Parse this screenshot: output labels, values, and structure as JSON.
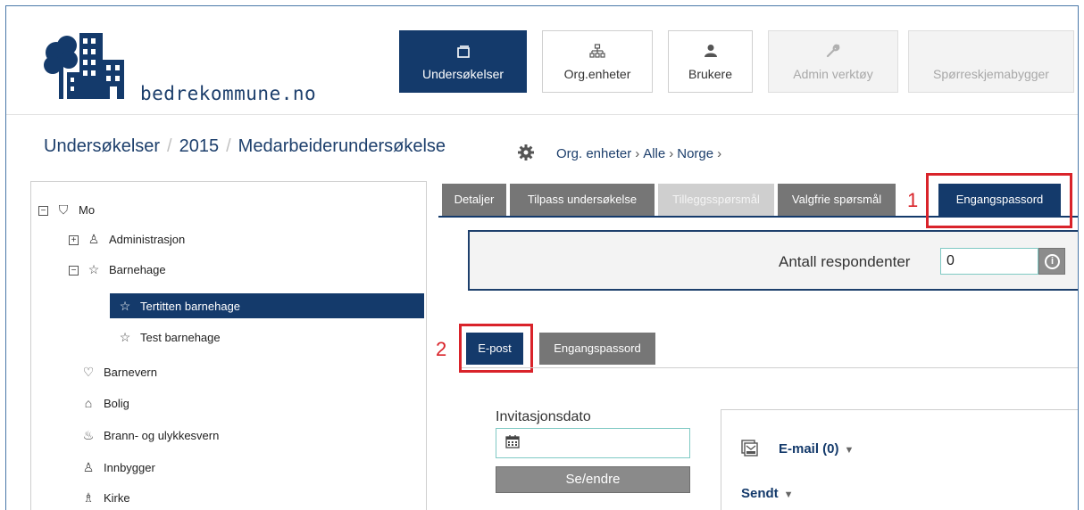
{
  "brand": {
    "name": "bedrekommune.no"
  },
  "nav": [
    {
      "label": "Undersøkelser",
      "icon": "window-icon",
      "state": "active"
    },
    {
      "label": "Org.enheter",
      "icon": "org-chart-icon",
      "state": "normal"
    },
    {
      "label": "Brukere",
      "icon": "user-icon",
      "state": "normal"
    },
    {
      "label": "Admin verktøy",
      "icon": "wrench-icon",
      "state": "disabled"
    },
    {
      "label": "Spørreskjemabygger",
      "icon": "",
      "state": "disabled"
    }
  ],
  "breadcrumb": {
    "items": [
      "Undersøkelser",
      "2015",
      "Medarbeiderundersøkelse"
    ],
    "separator": "/"
  },
  "org_path": {
    "items": [
      "Org. enheter",
      "Alle",
      "Norge"
    ]
  },
  "tree": [
    {
      "label": "Mo",
      "expander": "minus",
      "icon": "shield-icon"
    },
    {
      "label": "Administrasjon",
      "expander": "plus",
      "icon": "people-icon"
    },
    {
      "label": "Barnehage",
      "expander": "minus",
      "icon": "children-icon"
    },
    {
      "label": "Tertitten barnehage",
      "expander": "",
      "icon": "children-icon",
      "selected": true
    },
    {
      "label": "Test barnehage",
      "expander": "",
      "icon": "children-icon"
    },
    {
      "label": "Barnevern",
      "expander": "",
      "icon": "care-icon"
    },
    {
      "label": "Bolig",
      "expander": "",
      "icon": "house-icon"
    },
    {
      "label": "Brann- og ulykkesvern",
      "expander": "",
      "icon": "fire-icon"
    },
    {
      "label": "Innbygger",
      "expander": "",
      "icon": "citizens-icon"
    },
    {
      "label": "Kirke",
      "expander": "",
      "icon": "church-icon"
    }
  ],
  "tabs": [
    {
      "label": "Detaljer",
      "state": "normal"
    },
    {
      "label": "Tilpass undersøkelse",
      "state": "normal"
    },
    {
      "label": "Tilleggsspørsmål",
      "state": "disabled"
    },
    {
      "label": "Valgfrie spørsmål",
      "state": "normal"
    },
    {
      "label": "Engangspassord",
      "state": "active"
    }
  ],
  "annotations": [
    "1",
    "2"
  ],
  "respondents": {
    "label": "Antall respondenter",
    "value": "0"
  },
  "subtabs": [
    {
      "label": "E-post",
      "state": "active"
    },
    {
      "label": "Engangspassord",
      "state": "inactive"
    }
  ],
  "invitation": {
    "label": "Invitasjonsdato",
    "value": "",
    "button": "Se/endre"
  },
  "email": {
    "title": "E-mail (0)",
    "sent": "Sendt",
    "caret": "▼"
  },
  "colors": {
    "primary": "#143a6b",
    "tab_gray": "#767676",
    "annotation_red": "#d9232a",
    "input_border": "#7fc9c4"
  }
}
